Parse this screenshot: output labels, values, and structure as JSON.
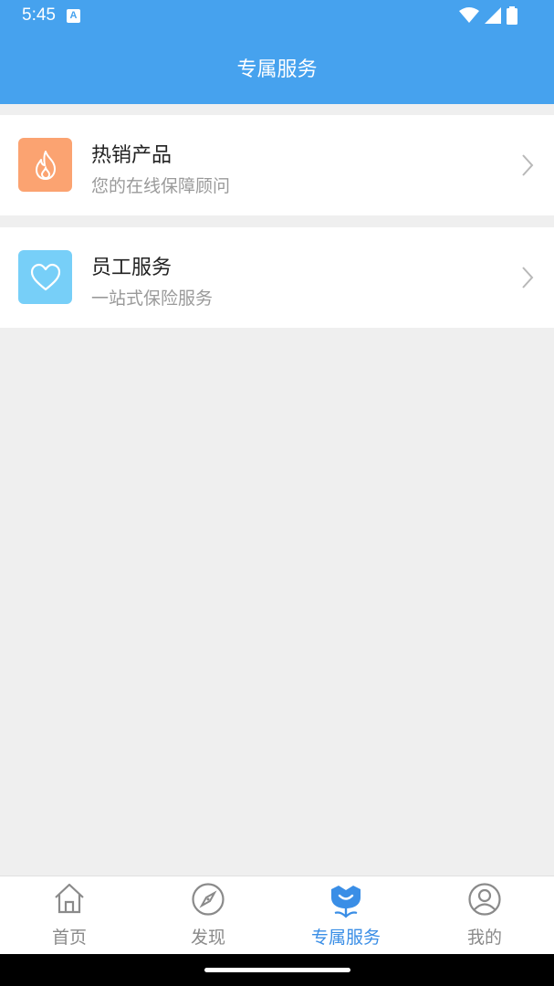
{
  "status_bar": {
    "time": "5:45",
    "notification_letter": "A"
  },
  "app_bar": {
    "title": "专属服务"
  },
  "cards": [
    {
      "title": "热销产品",
      "subtitle": "您的在线保障顾问",
      "icon": "flame-icon",
      "color": "#fba371"
    },
    {
      "title": "员工服务",
      "subtitle": "一站式保险服务",
      "icon": "heart-icon",
      "color": "#77cff8"
    }
  ],
  "bottom_nav": {
    "items": [
      {
        "label": "首页",
        "icon": "home-icon",
        "active": false
      },
      {
        "label": "发现",
        "icon": "compass-icon",
        "active": false
      },
      {
        "label": "专属服务",
        "icon": "service-flower-icon",
        "active": true
      },
      {
        "label": "我的",
        "icon": "user-icon",
        "active": false
      }
    ]
  },
  "colors": {
    "primary": "#46a2ee",
    "active_tab": "#3a8ee6",
    "inactive_tab": "#8a8a8a",
    "background": "#efefef"
  }
}
